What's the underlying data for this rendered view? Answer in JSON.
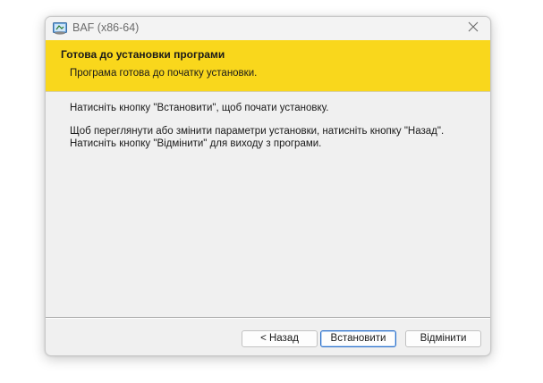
{
  "window": {
    "title": "BAF (x86-64)"
  },
  "banner": {
    "title": "Готова до установки програми",
    "subtitle": "Програма готова до початку установки."
  },
  "body": {
    "line1": "Натисніть кнопку \"Встановити\", щоб почати установку.",
    "line2": "Щоб переглянути або змінити параметри установки, натисніть кнопку \"Назад\".",
    "line3": "Натисніть кнопку \"Відмінити\" для виходу з програми."
  },
  "buttons": {
    "back": "< Назад",
    "install": "Встановити",
    "cancel": "Відмінити"
  },
  "colors": {
    "banner": "#f9d71c",
    "default_button_border": "#2b6fc9"
  }
}
